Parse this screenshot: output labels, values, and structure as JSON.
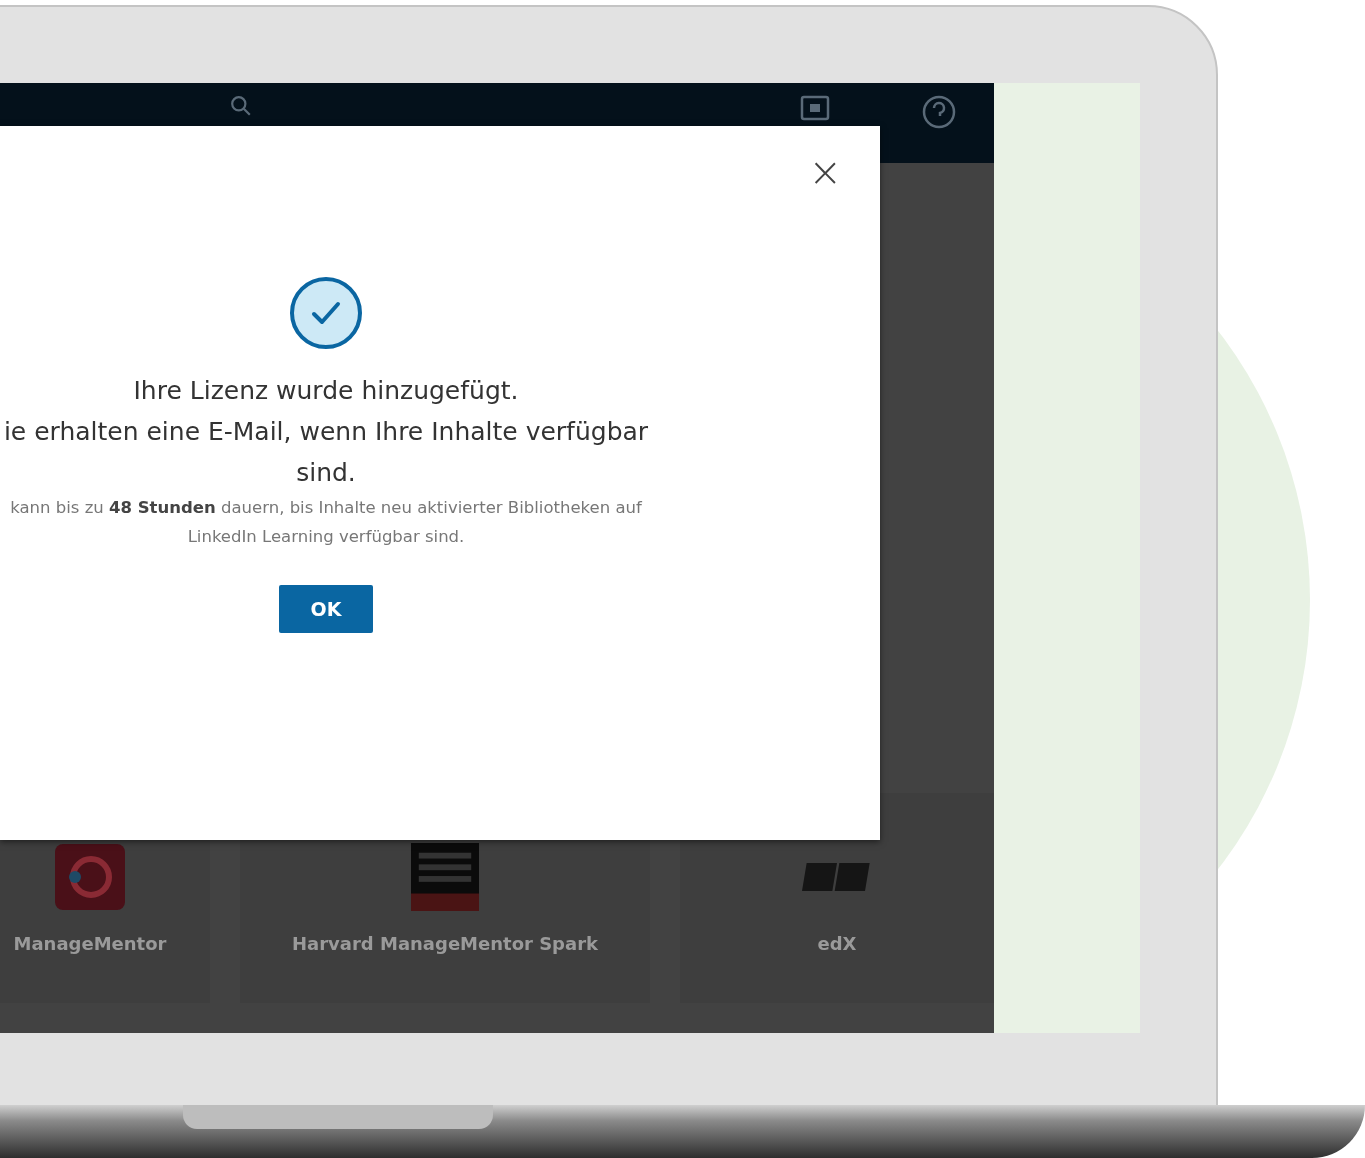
{
  "dialog": {
    "title": "Ihre Lizenz wurde hinzugefügt.",
    "message": "ie erhalten eine E-Mail, wenn Ihre Inhalte verfügbar sind.",
    "note": "kann bis zu **48 Stunden** dauern, bis Inhalte neu aktivierter Bibliotheken auf LinkedIn Learning verfügbar sind.",
    "ok_button": "OK",
    "close": "×"
  },
  "libraries": [
    {
      "name": "ManageMentor",
      "kind": "ring"
    },
    {
      "name": "Harvard ManageMentor Spark",
      "kind": "book"
    },
    {
      "name": "edX",
      "kind": "logo"
    }
  ]
}
